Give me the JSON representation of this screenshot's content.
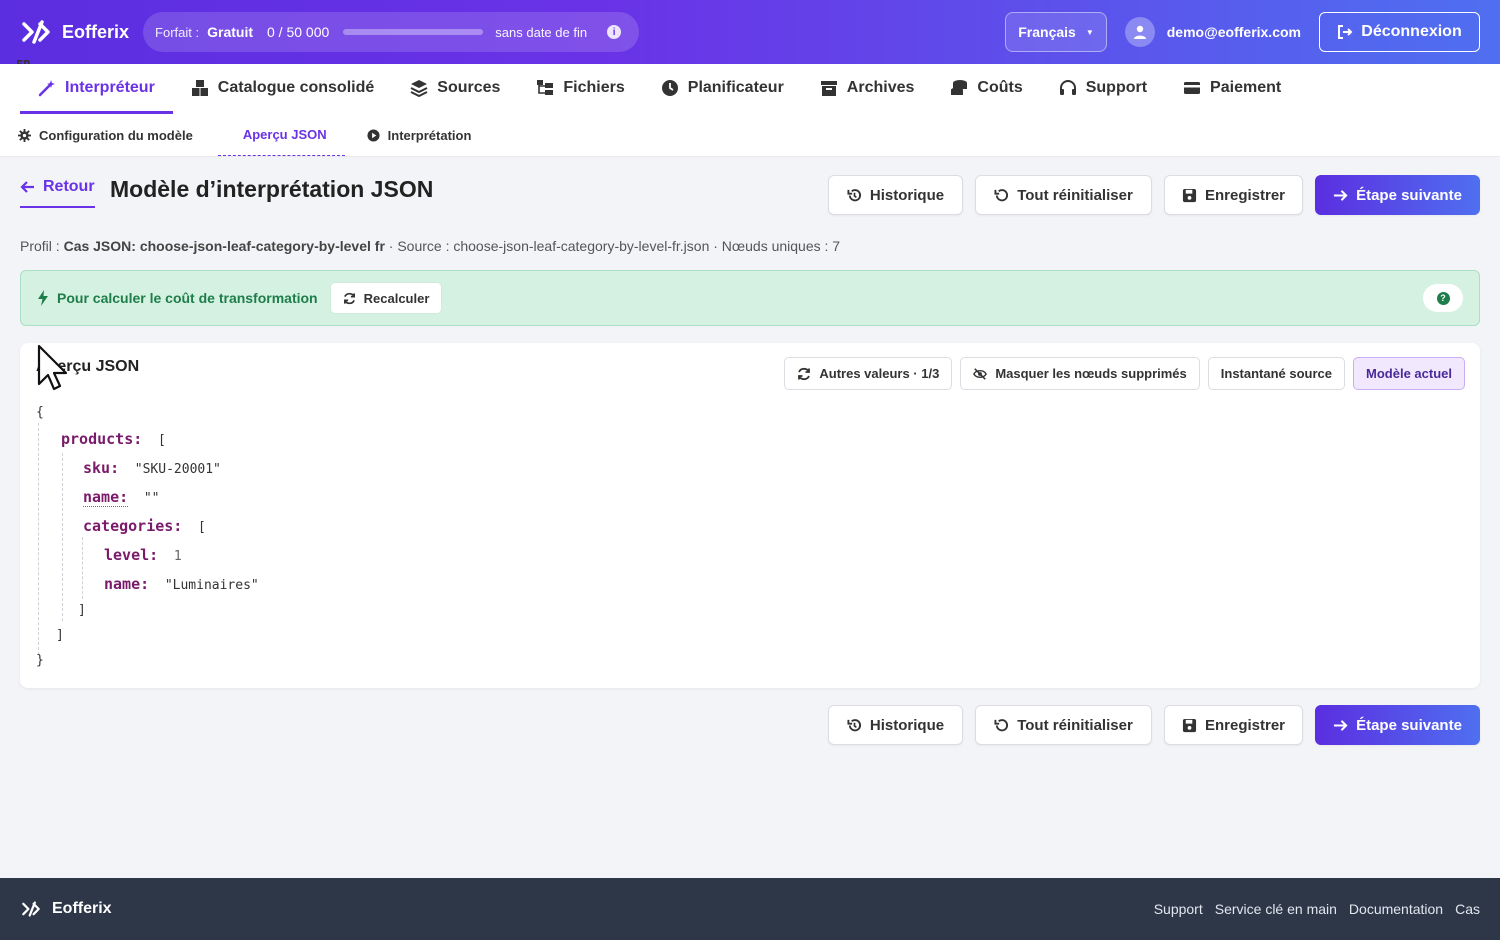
{
  "app": {
    "name": "Eofferix"
  },
  "plan": {
    "label": "Forfait :",
    "tier": "Gratuit",
    "count": "0 / 50 000",
    "progress": 0.0,
    "end": "sans date de fin"
  },
  "lang": {
    "code": "FR",
    "name": "Français"
  },
  "user": {
    "email": "demo@eofferix.com"
  },
  "logout_label": "Déconnexion",
  "nav": [
    {
      "label": "Interpréteur",
      "icon": "magic-wand-icon",
      "active": true
    },
    {
      "label": "Catalogue consolidé",
      "icon": "boxes-icon"
    },
    {
      "label": "Sources",
      "icon": "layers-icon"
    },
    {
      "label": "Fichiers",
      "icon": "folder-tree-icon"
    },
    {
      "label": "Planificateur",
      "icon": "clock-icon"
    },
    {
      "label": "Archives",
      "icon": "archive-icon"
    },
    {
      "label": "Coûts",
      "icon": "coins-icon"
    },
    {
      "label": "Support",
      "icon": "headset-icon"
    },
    {
      "label": "Paiement",
      "icon": "credit-card-icon"
    }
  ],
  "subnav": [
    {
      "label": "Configuration du modèle",
      "icon": "gear-icon"
    },
    {
      "label": "Aperçu JSON",
      "active": true
    },
    {
      "label": "Interprétation",
      "icon": "play-icon"
    }
  ],
  "header": {
    "back_label": "Retour",
    "title": "Modèle d’interprétation JSON",
    "actions": {
      "history": "Historique",
      "reset": "Tout réinitialiser",
      "save": "Enregistrer",
      "next": "Étape suivante"
    }
  },
  "meta": {
    "profile_label": "Profil :",
    "profile_value": "Cas JSON: choose-json-leaf-category-by-level fr",
    "source": "· Source : choose-json-leaf-category-by-level-fr.json · Nœuds uniques : 7"
  },
  "notice": {
    "text": "Pour calculer le coût de transformation",
    "button": "Recalculer"
  },
  "panel": {
    "title": "Aperçu JSON",
    "toolbar": {
      "other_values": "Autres valeurs · 1/3",
      "hide_deleted": "Masquer les nœuds supprimés",
      "source_snapshot": "Instantané source",
      "current_model": "Modèle actuel"
    }
  },
  "json": {
    "open_brace": "{",
    "close_brace": "}",
    "products_key": "products:",
    "open_bracket": "[",
    "close_bracket": "]",
    "sku_key": "sku:",
    "sku_value": "\"SKU-20001\"",
    "name_key": "name:",
    "name_value": "\"\"",
    "categories_key": "categories:",
    "level_key": "level:",
    "level_value": "1",
    "cat_name_key": "name:",
    "cat_name_value": "\"Luminaires\""
  },
  "footer": {
    "brand": "Eofferix",
    "links": [
      "Support",
      "Service clé en main",
      "Documentation",
      "Cas"
    ]
  }
}
